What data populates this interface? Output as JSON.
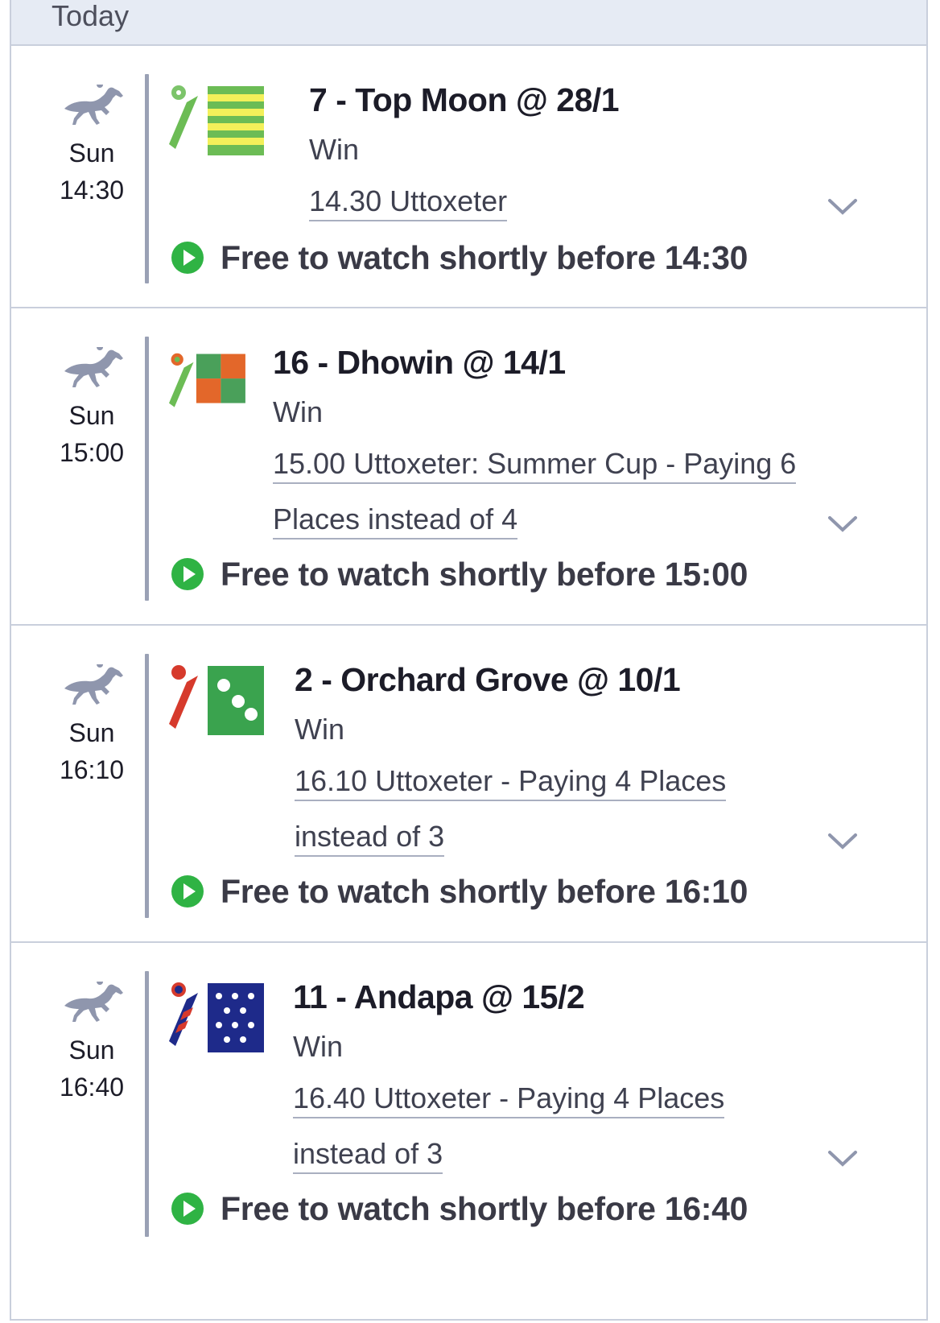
{
  "day_header": "Today",
  "colors": {
    "accent_green": "#2fb344",
    "divider": "#9aa1b5",
    "header_bg": "#e6ebf4"
  },
  "bets": [
    {
      "day": "Sun",
      "time": "14:30",
      "title": "7 - Top Moon @ 28/1",
      "bet_type": "Win",
      "race": "14.30 Uttoxeter",
      "race_line2": "",
      "watch": "Free to watch shortly before 14:30",
      "silk_icon": "jockey-silk-yellow-green-hoops-icon"
    },
    {
      "day": "Sun",
      "time": "15:00",
      "title": "16 - Dhowin @ 14/1",
      "bet_type": "Win",
      "race": "15.00 Uttoxeter: Summer Cup - Paying 6",
      "race_line2": "Places instead of 4",
      "watch": "Free to watch shortly before 15:00",
      "silk_icon": "jockey-silk-green-orange-quartered-icon"
    },
    {
      "day": "Sun",
      "time": "16:10",
      "title": "2 - Orchard Grove @ 10/1",
      "bet_type": "Win",
      "race": "16.10 Uttoxeter - Paying 4 Places",
      "race_line2": "instead of 3",
      "watch": "Free to watch shortly before 16:10",
      "silk_icon": "jockey-silk-green-white-spots-icon"
    },
    {
      "day": "Sun",
      "time": "16:40",
      "title": "11 - Andapa @ 15/2",
      "bet_type": "Win",
      "race": "16.40 Uttoxeter - Paying 4 Places",
      "race_line2": "instead of 3",
      "watch": "Free to watch shortly before 16:40",
      "silk_icon": "jockey-silk-blue-white-stars-icon"
    }
  ]
}
